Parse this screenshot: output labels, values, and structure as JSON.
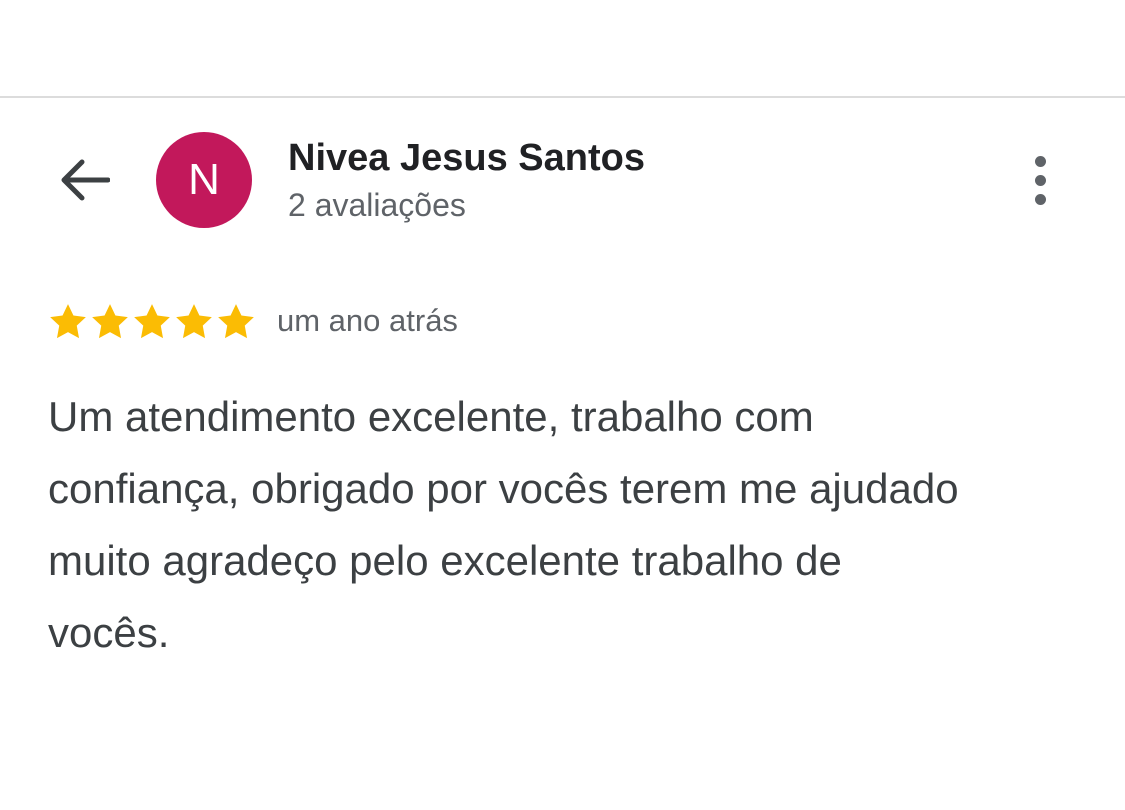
{
  "reviewer": {
    "name": "Nivea Jesus Santos",
    "avatar_initial": "N",
    "avatar_color": "#c2185b",
    "review_count": "2 avaliações"
  },
  "review": {
    "rating": 5,
    "max_rating": 5,
    "star_color": "#fbbc04",
    "time": "um ano atrás",
    "text": "Um atendimento excelente, trabalho com confiança, obrigado por vocês terem me ajudado muito agradeço pelo excelente trabalho de vocês."
  },
  "icons": {
    "back": "back-arrow-icon",
    "more": "more-vert-icon",
    "star": "star-icon"
  }
}
